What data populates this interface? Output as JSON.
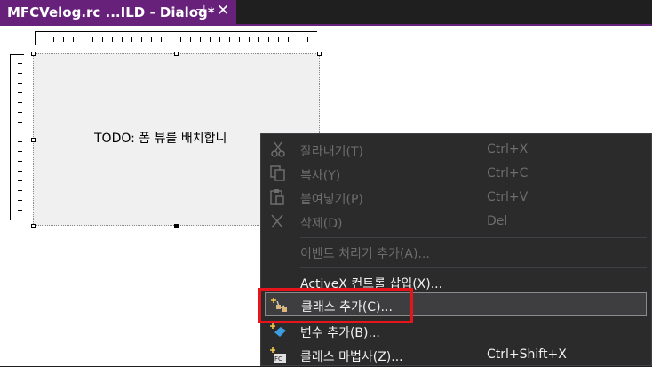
{
  "tab": {
    "title": "MFCVelog.rc ...ILD - Dialog*",
    "pin_glyph": "⊣",
    "close_glyph": "✕"
  },
  "dialog": {
    "placeholder_text": "TODO: 폼 뷰를 배치합니"
  },
  "context_menu": {
    "items": [
      {
        "label": "잘라내기(T)",
        "shortcut": "Ctrl+X",
        "icon": "cut-icon",
        "enabled": false
      },
      {
        "label": "복사(Y)",
        "shortcut": "Ctrl+C",
        "icon": "copy-icon",
        "enabled": false
      },
      {
        "label": "붙여넣기(P)",
        "shortcut": "Ctrl+V",
        "icon": "paste-icon",
        "enabled": false
      },
      {
        "label": "삭제(D)",
        "shortcut": "Del",
        "icon": "delete-icon",
        "enabled": false
      },
      {
        "label": "이벤트 처리기 추가(A)...",
        "shortcut": "",
        "icon": "",
        "enabled": false
      },
      {
        "label": "ActiveX 컨트롤 삽입(X)...",
        "shortcut": "",
        "icon": "",
        "enabled": true
      },
      {
        "label": "클래스 추가(C)...",
        "shortcut": "",
        "icon": "add-class-icon",
        "enabled": true,
        "highlighted": true
      },
      {
        "label": "변수 추가(B)...",
        "shortcut": "",
        "icon": "add-variable-icon",
        "enabled": true
      },
      {
        "label": "클래스 마법사(Z)...",
        "shortcut": "Ctrl+Shift+X",
        "icon": "class-wizard-icon",
        "enabled": true
      }
    ]
  },
  "colors": {
    "accent": "#68217a",
    "menu_bg": "#2b2b2b",
    "highlight_box": "#e8141b"
  }
}
